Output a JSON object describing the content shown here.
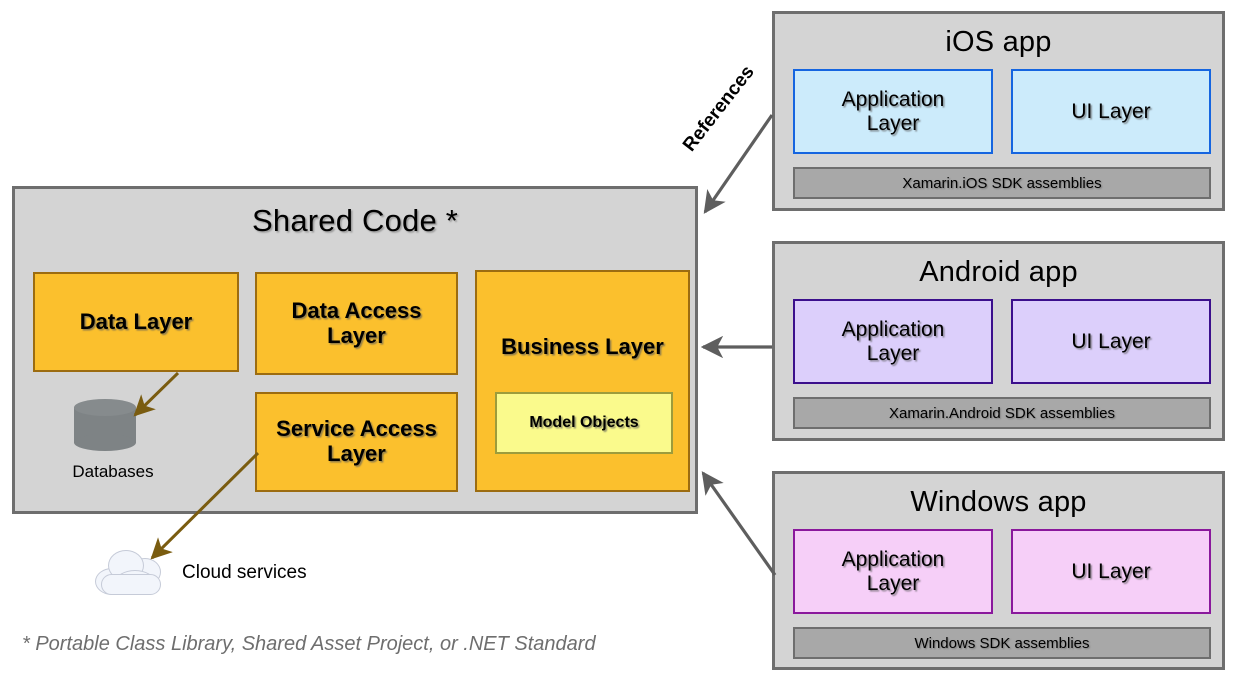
{
  "diagram": {
    "title": "Shared Code *",
    "footnote": "* Portable Class Library, Shared Asset Project, or .NET Standard",
    "reference_label": "References"
  },
  "shared_code": {
    "title": "Shared Code *",
    "layers": [
      {
        "id": "data-layer",
        "label": "Data Layer"
      },
      {
        "id": "data-access-layer",
        "label": "Data Access\nLayer"
      },
      {
        "id": "service-access-layer",
        "label": "Service Access\nLayer"
      },
      {
        "id": "business-layer",
        "label": "Business Layer"
      }
    ],
    "business_layer": {
      "label": "Business Layer",
      "inner": {
        "id": "model-objects",
        "label": "Model Objects"
      }
    },
    "external": [
      {
        "id": "databases",
        "label": "Databases",
        "icon": "database-cylinder-icon"
      },
      {
        "id": "cloud-services",
        "label": "Cloud services",
        "icon": "cloud-icon"
      }
    ]
  },
  "platforms": [
    {
      "id": "ios",
      "title": "iOS app",
      "application_layer": "Application\nLayer",
      "ui_layer": "UI Layer",
      "sdk": "Xamarin.iOS SDK assemblies",
      "fill": "#CCEBFB",
      "border": "#1565E0"
    },
    {
      "id": "android",
      "title": "Android app",
      "application_layer": "Application\nLayer",
      "ui_layer": "UI Layer",
      "sdk": "Xamarin.Android SDK assemblies",
      "fill": "#DCCFFB",
      "border": "#3B0F8C"
    },
    {
      "id": "windows",
      "title": "Windows app",
      "application_layer": "Application\nLayer",
      "ui_layer": "UI Layer",
      "sdk": "Windows SDK assemblies",
      "fill": "#F6CFF8",
      "border": "#8A189C"
    }
  ],
  "colors": {
    "panel_fill": "#D4D4D4",
    "panel_border": "#6E6E6E",
    "shared_layer_fill": "#FBC02D",
    "shared_layer_border": "#9C6C10",
    "model_objects_fill": "#FAFA8C",
    "model_objects_border": "#9C9C3C",
    "sdk_fill": "#A8A8A8",
    "arrow_gray": "#5E5E5E",
    "arrow_olive": "#7A5C10",
    "database_fill": "#7E8385",
    "footnote_text": "#6E6E6E"
  }
}
